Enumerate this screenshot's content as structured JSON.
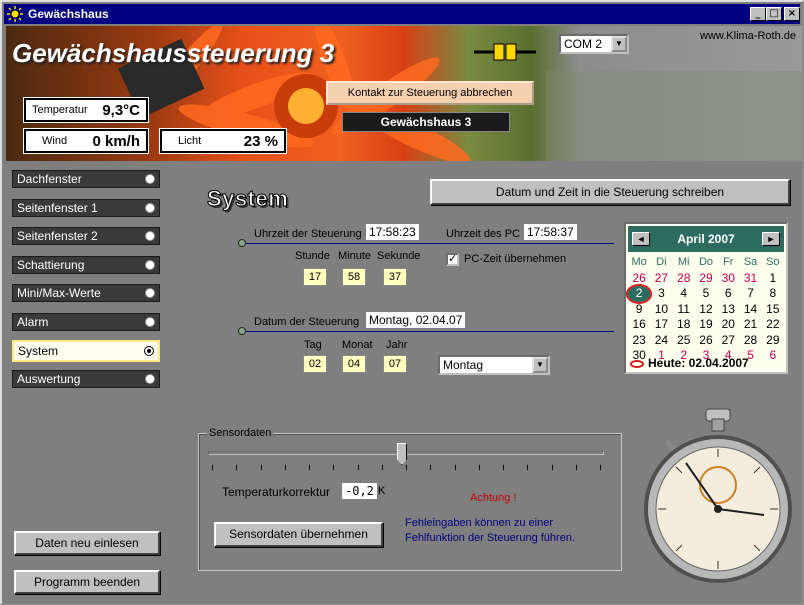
{
  "window": {
    "title": "Gewächshaus",
    "controls": [
      "_",
      "□",
      "×"
    ]
  },
  "header": {
    "title": "Gewächshaussteuerung 3",
    "website": "www.Klima-Roth.de",
    "com_port": "COM 2",
    "temperature_label": "Temperatur",
    "temperature_value": "9,3°C",
    "wind_label": "Wind",
    "wind_value": "0 km/h",
    "light_label": "Licht",
    "light_value": "23 %",
    "abort_contact_label": "Kontakt zur Steuerung abbrechen",
    "greenhouse_name": "Gewächshaus 3"
  },
  "nav": {
    "items": [
      {
        "label": "Dachfenster",
        "selected": false
      },
      {
        "label": "Seitenfenster 1",
        "selected": false
      },
      {
        "label": "Seitenfenster 2",
        "selected": false
      },
      {
        "label": "Schattierung",
        "selected": false
      },
      {
        "label": "Mini/Max-Werte",
        "selected": false
      },
      {
        "label": "Alarm",
        "selected": false
      },
      {
        "label": "System",
        "selected": true
      },
      {
        "label": "Auswertung",
        "selected": false
      }
    ],
    "reload_label": "Daten neu einlesen",
    "exit_label": "Programm beenden"
  },
  "system": {
    "title": "System",
    "write_datetime_label": "Datum und Zeit in die Steuerung schreiben",
    "controller_time_label": "Uhrzeit der Steuerung",
    "controller_time": "17:58:23",
    "pc_time_label": "Uhrzeit des PC",
    "pc_time": "17:58:37",
    "hour_label": "Stunde",
    "minute_label": "Minute",
    "second_label": "Sekunde",
    "hour": "17",
    "minute": "58",
    "second": "37",
    "use_pc_time_label": "PC-Zeit übernehmen",
    "use_pc_time_checked": true,
    "controller_date_label": "Datum der Steuerung",
    "controller_date": "Montag, 02.04.07",
    "day_label": "Tag",
    "month_label": "Monat",
    "year_label": "Jahr",
    "day": "02",
    "month": "04",
    "year": "07",
    "weekday_selected": "Montag"
  },
  "calendar": {
    "month_label": "April 2007",
    "prev": "◄",
    "next": "►",
    "weekdays": [
      "Mo",
      "Di",
      "Mi",
      "Do",
      "Fr",
      "Sa",
      "So"
    ],
    "weeks": [
      [
        "26",
        "27",
        "28",
        "29",
        "30",
        "31",
        "1"
      ],
      [
        "2",
        "3",
        "4",
        "5",
        "6",
        "7",
        "8"
      ],
      [
        "9",
        "10",
        "11",
        "12",
        "13",
        "14",
        "15"
      ],
      [
        "16",
        "17",
        "18",
        "19",
        "20",
        "21",
        "22"
      ],
      [
        "23",
        "24",
        "25",
        "26",
        "27",
        "28",
        "29"
      ],
      [
        "30",
        "1",
        "2",
        "3",
        "4",
        "5",
        "6"
      ]
    ],
    "selected_day": "2",
    "today_label": "Heute: 02.04.2007"
  },
  "sensor": {
    "group_title": "Sensordaten",
    "slider_fraction": 0.49,
    "tick_count": 17,
    "temp_correction_label": "Temperaturkorrektur",
    "temp_correction_value": "-0,2",
    "temp_correction_unit": "K",
    "warning": "Achtung !",
    "warning_note": "Fehleingaben können zu einer Fehlfunktion der Steuerung führen.",
    "apply_label": "Sensordaten übernehmen"
  },
  "colors": {
    "titlebar": "#000080",
    "calendar_accent": "#2c6c60",
    "input_yellow": "#ffffc0",
    "warning": "#c00000"
  }
}
